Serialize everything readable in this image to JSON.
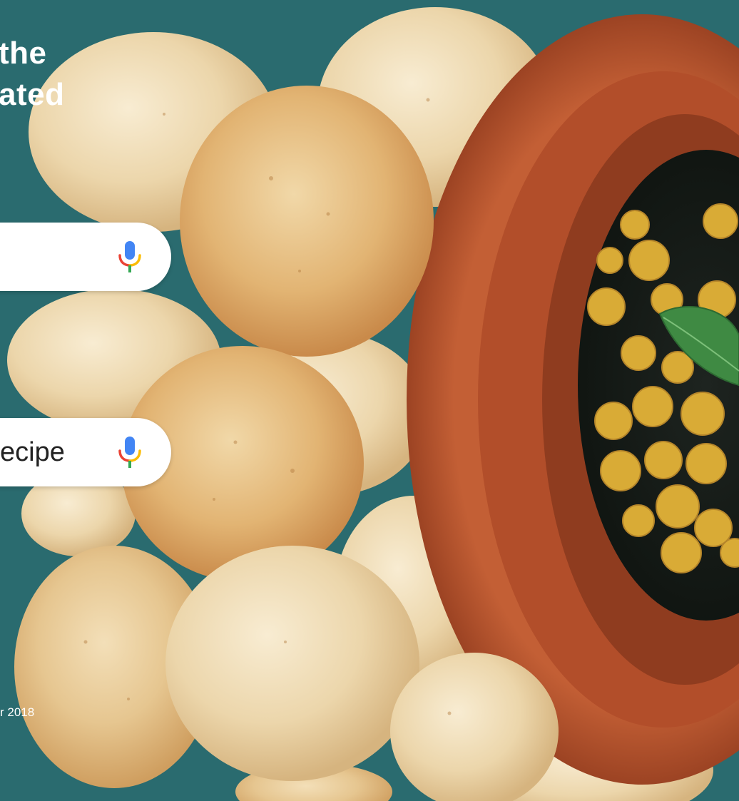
{
  "headline": {
    "line1": "the",
    "line2": "ated"
  },
  "search_boxes": [
    {
      "text": "",
      "icon": "mic-icon"
    },
    {
      "text": "ecipe",
      "icon": "mic-icon"
    }
  ],
  "footer": {
    "note": "r 2018"
  },
  "colors": {
    "background": "#2a6b6f",
    "mic_blue": "#4285f4",
    "mic_red": "#ea4335",
    "mic_yellow": "#fbbc05",
    "mic_green": "#34a853",
    "pot": "#b5532c"
  }
}
